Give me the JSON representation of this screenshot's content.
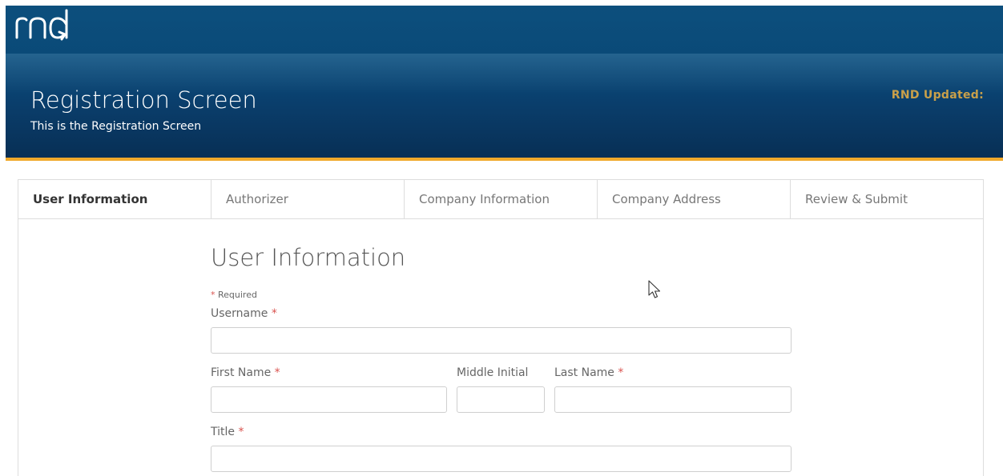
{
  "header": {
    "logo_text": "rnd",
    "title": "Registration Screen",
    "subtitle": "This is the Registration Screen",
    "updated_label": "RND Updated:"
  },
  "tabs": [
    {
      "label": "User Information",
      "active": true
    },
    {
      "label": "Authorizer",
      "active": false
    },
    {
      "label": "Company Information",
      "active": false
    },
    {
      "label": "Company Address",
      "active": false
    },
    {
      "label": "Review & Submit",
      "active": false
    }
  ],
  "form": {
    "title": "User Information",
    "required_note": "Required",
    "required_marker": "*",
    "fields": {
      "username": {
        "label": "Username",
        "required": true,
        "value": ""
      },
      "first_name": {
        "label": "First Name",
        "required": true,
        "value": ""
      },
      "middle_initial": {
        "label": "Middle Initial",
        "required": false,
        "value": ""
      },
      "last_name": {
        "label": "Last Name",
        "required": true,
        "value": ""
      },
      "title": {
        "label": "Title",
        "required": true,
        "value": ""
      }
    }
  },
  "colors": {
    "header_blue": "#0a4a78",
    "accent_orange": "#f0a92b",
    "updated_gold": "#c9a04a",
    "required_red": "#d9534f"
  },
  "icons": {
    "cursor": "mouse-pointer-icon"
  }
}
